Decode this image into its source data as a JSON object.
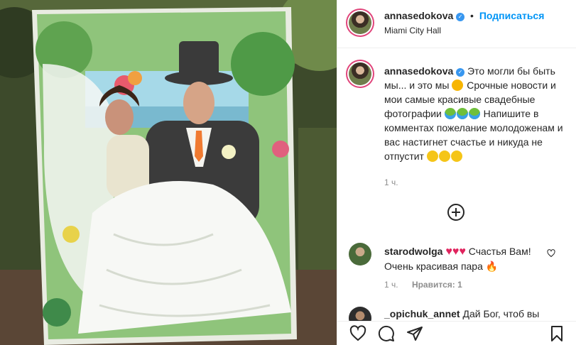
{
  "header": {
    "username": "annasedokova",
    "follow_label": "Подписаться",
    "separator": "•",
    "location": "Miami City Hall"
  },
  "caption": {
    "username": "annasedokova",
    "text_part1": "Это могли бы быть мы... и это мы",
    "text_part2": "Срочные новости и мои самые красивые свадебные фотографии",
    "text_part3": "Напишите в комментах пожелание молодоженам и вас настигнет счастье и никуда не отпустит",
    "time": "1 ч."
  },
  "comments": [
    {
      "username": "starodwolga",
      "text_part1": "Счастья Вам! Очень красивая пара",
      "time": "1 ч.",
      "likes": "Нравится: 1"
    },
    {
      "username": "_opichuk_annet",
      "text_part1": "Дай Бог, чтоб вы"
    }
  ],
  "icons": [
    "heart-icon",
    "comment-icon",
    "share-icon",
    "bookmark-icon",
    "verified-icon",
    "load-more-icon",
    "like-icon"
  ],
  "colors": {
    "accent": "#0095f6",
    "verified": "#3897f0",
    "muted": "#8e8e8e",
    "story_ring": "#e0457b"
  }
}
